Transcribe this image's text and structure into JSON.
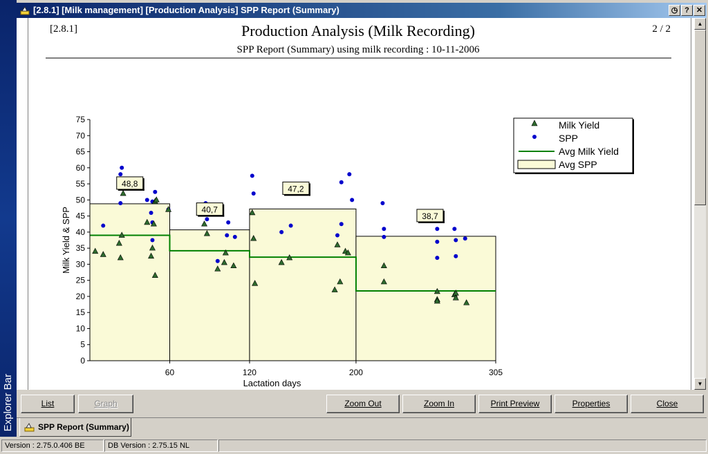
{
  "window": {
    "title": "[2.8.1] [Milk management] [Production Analysis] SPP Report (Summary)",
    "controls": {
      "clock": "◷",
      "help": "?",
      "close": "✕"
    }
  },
  "explorer_bar": {
    "label": "Explorer Bar"
  },
  "report": {
    "code": "[2.8.1]",
    "title": "Production Analysis (Milk Recording)",
    "subtitle": "SPP Report (Summary) using milk recording : 10-11-2006",
    "page": "2 / 2"
  },
  "chart_data": {
    "type": "scatter",
    "xlabel": "Lactation days",
    "ylabel": "Milk Yield & SPP",
    "xlim": [
      0,
      305
    ],
    "ylim": [
      0,
      75
    ],
    "x_ticks": [
      60,
      120,
      200,
      305
    ],
    "y_ticks": [
      0,
      5,
      10,
      15,
      20,
      25,
      30,
      35,
      40,
      45,
      50,
      55,
      60,
      65,
      70,
      75
    ],
    "grid": false,
    "legend_position": "top-right",
    "legend": [
      "Milk Yield",
      "SPP",
      "Avg Milk Yield",
      "Avg SPP"
    ],
    "colors": {
      "milk_yield": "#1a5c1a",
      "spp": "#0000cc",
      "avg_line": "#008000",
      "avg_fill": "#fafad7"
    },
    "segments": [
      {
        "from": 0,
        "to": 60,
        "avg_spp": 48.8,
        "avg_spp_label": "48,8",
        "avg_milk_yield": 39
      },
      {
        "from": 60,
        "to": 120,
        "avg_spp": 40.7,
        "avg_spp_label": "40,7",
        "avg_milk_yield": 34.2
      },
      {
        "from": 120,
        "to": 200,
        "avg_spp": 47.2,
        "avg_spp_label": "47,2",
        "avg_milk_yield": 32.2
      },
      {
        "from": 200,
        "to": 305,
        "avg_spp": 38.7,
        "avg_spp_label": "38,7",
        "avg_milk_yield": 21.7
      }
    ],
    "series": [
      {
        "name": "SPP",
        "points": [
          [
            10,
            42
          ],
          [
            22,
            54
          ],
          [
            23,
            58
          ],
          [
            24,
            60
          ],
          [
            23,
            49
          ],
          [
            43,
            50
          ],
          [
            46,
            46
          ],
          [
            47,
            49.5
          ],
          [
            47,
            43
          ],
          [
            49,
            52.5
          ],
          [
            47,
            37.5
          ],
          [
            59,
            47
          ],
          [
            87,
            49
          ],
          [
            88,
            44
          ],
          [
            96,
            31
          ],
          [
            103,
            39
          ],
          [
            104,
            43
          ],
          [
            109,
            38.5
          ],
          [
            122,
            57.5
          ],
          [
            123,
            52
          ],
          [
            144,
            40
          ],
          [
            151,
            42
          ],
          [
            186,
            39
          ],
          [
            189,
            55.5
          ],
          [
            189,
            42.5
          ],
          [
            195,
            58
          ],
          [
            197,
            50
          ],
          [
            220,
            49
          ],
          [
            221,
            41
          ],
          [
            221,
            38.5
          ],
          [
            261,
            41
          ],
          [
            261,
            37
          ],
          [
            261,
            32
          ],
          [
            274,
            41
          ],
          [
            275,
            37.5
          ],
          [
            275,
            32.5
          ],
          [
            282,
            38
          ]
        ]
      },
      {
        "name": "Milk Yield",
        "points": [
          [
            4,
            34
          ],
          [
            10,
            33
          ],
          [
            22,
            36.5
          ],
          [
            23,
            32
          ],
          [
            24,
            39
          ],
          [
            25,
            52
          ],
          [
            43,
            43
          ],
          [
            46,
            32.5
          ],
          [
            47,
            35
          ],
          [
            48,
            42.5
          ],
          [
            49,
            26.5
          ],
          [
            49,
            49.5
          ],
          [
            50,
            50
          ],
          [
            59,
            47
          ],
          [
            86,
            42.5
          ],
          [
            88,
            39.5
          ],
          [
            96,
            28.5
          ],
          [
            101,
            30.5
          ],
          [
            102,
            33.5
          ],
          [
            108,
            29.5
          ],
          [
            122,
            46
          ],
          [
            123,
            38
          ],
          [
            124,
            24
          ],
          [
            144,
            30.5
          ],
          [
            150,
            32
          ],
          [
            184,
            22
          ],
          [
            186,
            36
          ],
          [
            188,
            24.5
          ],
          [
            192,
            34
          ],
          [
            194,
            33.5
          ],
          [
            221,
            29.5
          ],
          [
            221,
            24.5
          ],
          [
            261,
            21.5
          ],
          [
            261,
            19
          ],
          [
            261,
            18.5
          ],
          [
            274,
            20.5
          ],
          [
            275,
            21
          ],
          [
            275,
            19.5
          ],
          [
            283,
            18
          ]
        ]
      }
    ]
  },
  "toolbar": {
    "list": "List",
    "graph": "Graph",
    "zoom_out": "Zoom Out",
    "zoom_in": "Zoom In",
    "print_preview": "Print Preview",
    "properties": "Properties",
    "close": "Close"
  },
  "tabs": [
    {
      "label": "SPP Report (Summary)"
    }
  ],
  "statusbar": {
    "version": "Version : 2.75.0.406 BE",
    "db_version": "DB Version : 2.75.15 NL"
  }
}
